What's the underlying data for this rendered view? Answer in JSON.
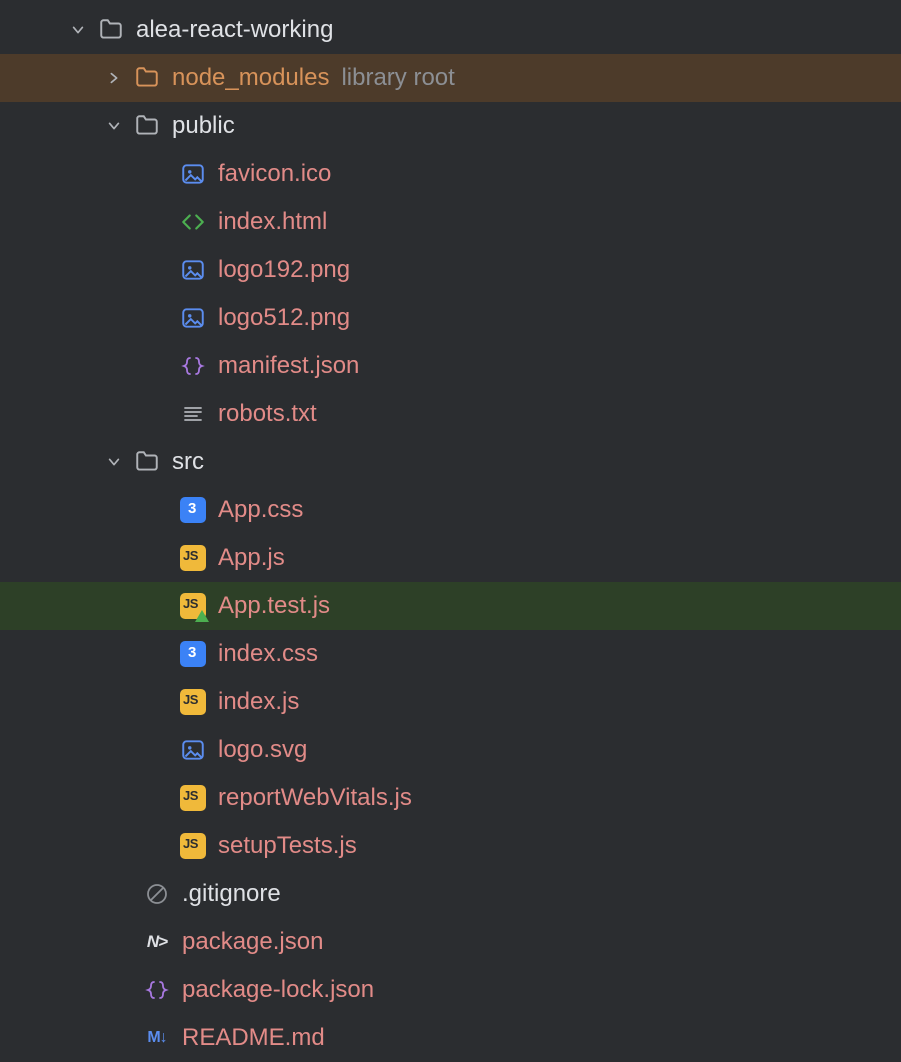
{
  "root": {
    "name": "alea-react-working"
  },
  "node_modules": {
    "name": "node_modules",
    "suffix": "library root"
  },
  "public": {
    "name": "public",
    "files": {
      "favicon": "favicon.ico",
      "index_html": "index.html",
      "logo192": "logo192.png",
      "logo512": "logo512.png",
      "manifest": "manifest.json",
      "robots": "robots.txt"
    }
  },
  "src": {
    "name": "src",
    "files": {
      "app_css": "App.css",
      "app_js": "App.js",
      "app_test": "App.test.js",
      "index_css": "index.css",
      "index_js": "index.js",
      "logo_svg": "logo.svg",
      "report": "reportWebVitals.js",
      "setup": "setupTests.js"
    }
  },
  "root_files": {
    "gitignore": ".gitignore",
    "package_json": "package.json",
    "package_lock": "package-lock.json",
    "readme": "README.md"
  }
}
